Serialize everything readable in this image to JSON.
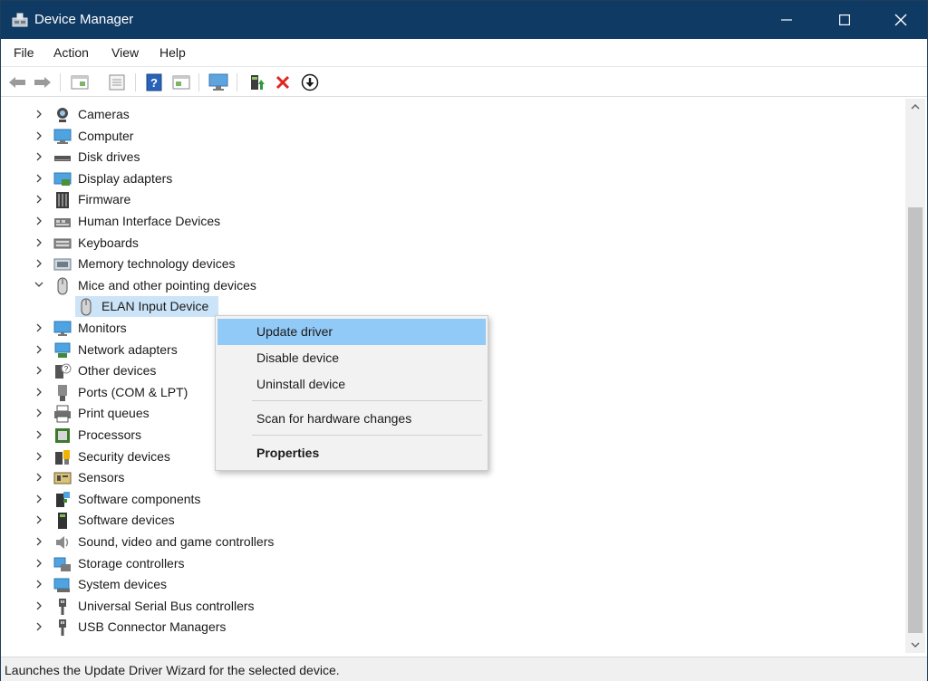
{
  "window": {
    "title": "Device Manager"
  },
  "menubar": {
    "items": [
      "File",
      "Action",
      "View",
      "Help"
    ]
  },
  "toolbar": {
    "buttons": [
      "back-icon",
      "forward-icon",
      "show-hide-console-tree-icon",
      "properties-icon",
      "help-icon",
      "action-pane-icon",
      "monitor-icon",
      "update-driver-icon",
      "uninstall-icon",
      "download-icon"
    ]
  },
  "tree": {
    "categories": [
      {
        "label": "Cameras",
        "icon": "camera-icon",
        "expanded": false
      },
      {
        "label": "Computer",
        "icon": "computer-icon",
        "expanded": false
      },
      {
        "label": "Disk drives",
        "icon": "disk-drive-icon",
        "expanded": false
      },
      {
        "label": "Display adapters",
        "icon": "display-adapter-icon",
        "expanded": false
      },
      {
        "label": "Firmware",
        "icon": "firmware-icon",
        "expanded": false
      },
      {
        "label": "Human Interface Devices",
        "icon": "hid-icon",
        "expanded": false
      },
      {
        "label": "Keyboards",
        "icon": "keyboard-icon",
        "expanded": false
      },
      {
        "label": "Memory technology devices",
        "icon": "memory-icon",
        "expanded": false
      },
      {
        "label": "Mice and other pointing devices",
        "icon": "mouse-icon",
        "expanded": true
      },
      {
        "label": "Monitors",
        "icon": "monitor-icon",
        "expanded": false
      },
      {
        "label": "Network adapters",
        "icon": "network-adapter-icon",
        "expanded": false
      },
      {
        "label": "Other devices",
        "icon": "other-devices-icon",
        "expanded": false
      },
      {
        "label": "Ports (COM & LPT)",
        "icon": "port-icon",
        "expanded": false
      },
      {
        "label": "Print queues",
        "icon": "printer-icon",
        "expanded": false
      },
      {
        "label": "Processors",
        "icon": "processor-icon",
        "expanded": false
      },
      {
        "label": "Security devices",
        "icon": "security-device-icon",
        "expanded": false
      },
      {
        "label": "Sensors",
        "icon": "sensor-icon",
        "expanded": false
      },
      {
        "label": "Software components",
        "icon": "software-component-icon",
        "expanded": false
      },
      {
        "label": "Software devices",
        "icon": "software-device-icon",
        "expanded": false
      },
      {
        "label": "Sound, video and game controllers",
        "icon": "speaker-icon",
        "expanded": false
      },
      {
        "label": "Storage controllers",
        "icon": "storage-controller-icon",
        "expanded": false
      },
      {
        "label": "System devices",
        "icon": "system-device-icon",
        "expanded": false
      },
      {
        "label": "Universal Serial Bus controllers",
        "icon": "usb-icon",
        "expanded": false
      },
      {
        "label": "USB Connector Managers",
        "icon": "usb-icon",
        "expanded": false
      }
    ],
    "selected_child": {
      "label": "ELAN Input Device",
      "icon": "mouse-icon",
      "parent": "Mice and other pointing devices"
    }
  },
  "context_menu": {
    "items": [
      {
        "label": "Update driver",
        "highlighted": true,
        "bold": false
      },
      {
        "label": "Disable device",
        "highlighted": false,
        "bold": false
      },
      {
        "label": "Uninstall device",
        "highlighted": false,
        "bold": false
      },
      {
        "label": "Scan for hardware changes",
        "highlighted": false,
        "bold": false
      },
      {
        "label": "Properties",
        "highlighted": false,
        "bold": true
      }
    ]
  },
  "statusbar": {
    "text": "Launches the Update Driver Wizard for the selected device."
  },
  "colors": {
    "titlebar": "#0f3a64",
    "selection": "#cce4f7",
    "menu_highlight": "#91c9f7",
    "delete_red": "#e0261c"
  }
}
